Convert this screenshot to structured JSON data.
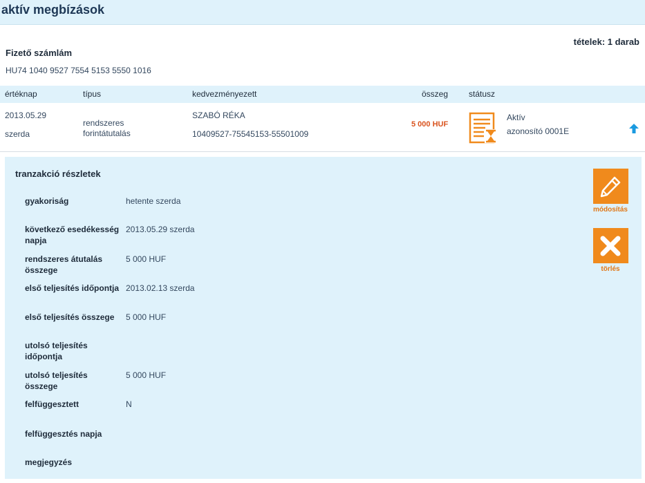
{
  "page": {
    "title": "aktív megbízások"
  },
  "summary": {
    "items_count": "tételek: 1 darab"
  },
  "account": {
    "label": "Fizető számlám",
    "number": "HU74 1040 9527 7554 5153 5550 1016"
  },
  "table": {
    "headers": [
      "értéknap",
      "típus",
      "kedvezményezett",
      "összeg",
      "státusz"
    ],
    "row": {
      "date": "2013.05.29",
      "day": "szerda",
      "type_line1": "rendszeres",
      "type_line2": "forintátutalás",
      "beneficiary_name": "SZABÓ RÉKA",
      "beneficiary_account": "10409527-75545153-55501009",
      "amount": "5 000 HUF",
      "status": "Aktív",
      "identifier": "azonosító 0001E"
    }
  },
  "details": {
    "title": "tranzakció részletek",
    "fields": [
      {
        "label": "gyakoriság",
        "value": "hetente szerda"
      },
      {
        "label": "következő esedékesség napja",
        "value": "2013.05.29 szerda"
      },
      {
        "label": "rendszeres átutalás összege",
        "value": "5 000 HUF"
      },
      {
        "label": "első teljesítés időpontja",
        "value": "2013.02.13 szerda"
      },
      {
        "label": "első teljesítés összege",
        "value": "5 000 HUF"
      },
      {
        "label": "utolsó teljesítés időpontja",
        "value": ""
      },
      {
        "label": "utolsó teljesítés összege",
        "value": "5 000 HUF"
      },
      {
        "label": "felfüggesztett",
        "value": "N"
      },
      {
        "label": "felfüggesztés napja",
        "value": ""
      },
      {
        "label": "megjegyzés",
        "value": ""
      }
    ]
  },
  "actions": {
    "edit_label": "módosítás",
    "delete_label": "törlés"
  },
  "colors": {
    "accent": "#f08a1c",
    "amount": "#d9531e",
    "header_bg": "#dff2fb",
    "arrow": "#1a9ae0"
  },
  "icons": {
    "status": "document-hourglass-icon",
    "collapse": "arrow-up-icon",
    "edit": "pencil-icon",
    "delete": "close-x-icon"
  }
}
